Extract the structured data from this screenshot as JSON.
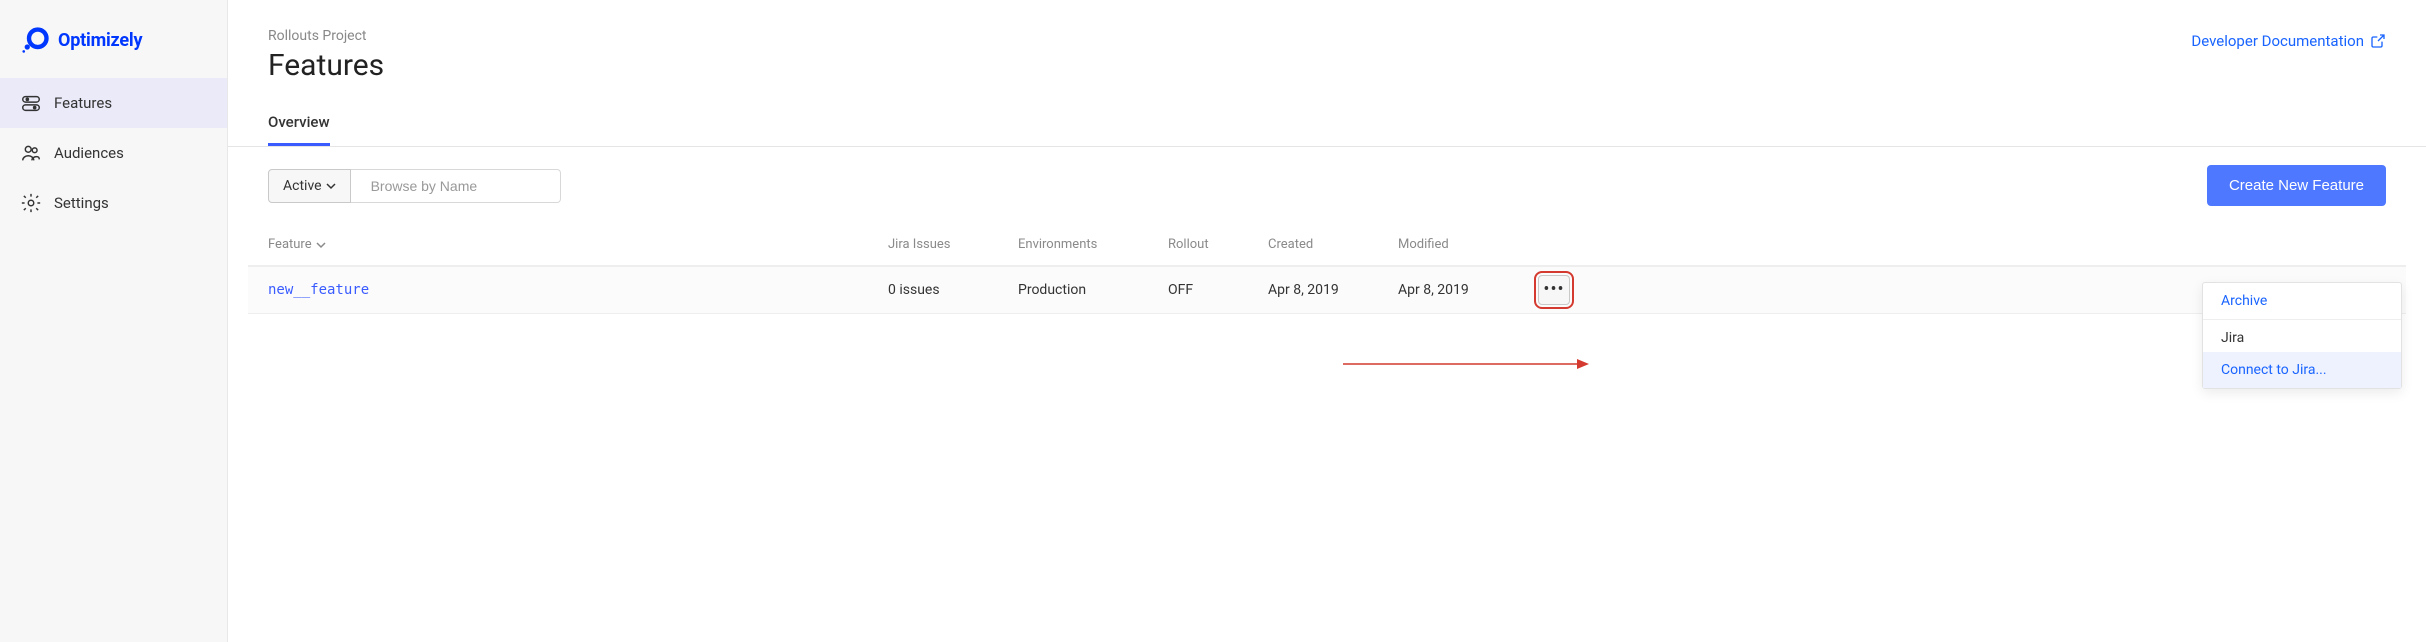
{
  "brand": "Optimizely",
  "sidebar": {
    "items": [
      {
        "label": "Features"
      },
      {
        "label": "Audiences"
      },
      {
        "label": "Settings"
      }
    ]
  },
  "header": {
    "breadcrumb": "Rollouts Project",
    "title": "Features",
    "dev_doc": "Developer Documentation"
  },
  "tabs": [
    {
      "label": "Overview"
    }
  ],
  "toolbar": {
    "filter_label": "Active",
    "search_placeholder": "Browse by Name",
    "create_label": "Create New Feature"
  },
  "table": {
    "headers": {
      "feature": "Feature",
      "jira": "Jira Issues",
      "env": "Environments",
      "rollout": "Rollout",
      "created": "Created",
      "modified": "Modified"
    },
    "rows": [
      {
        "name": "new__feature",
        "jira": "0 issues",
        "env": "Production",
        "rollout": "OFF",
        "created": "Apr 8, 2019",
        "modified": "Apr 8, 2019"
      }
    ]
  },
  "menu": {
    "archive": "Archive",
    "section": "Jira",
    "connect": "Connect to Jira..."
  }
}
